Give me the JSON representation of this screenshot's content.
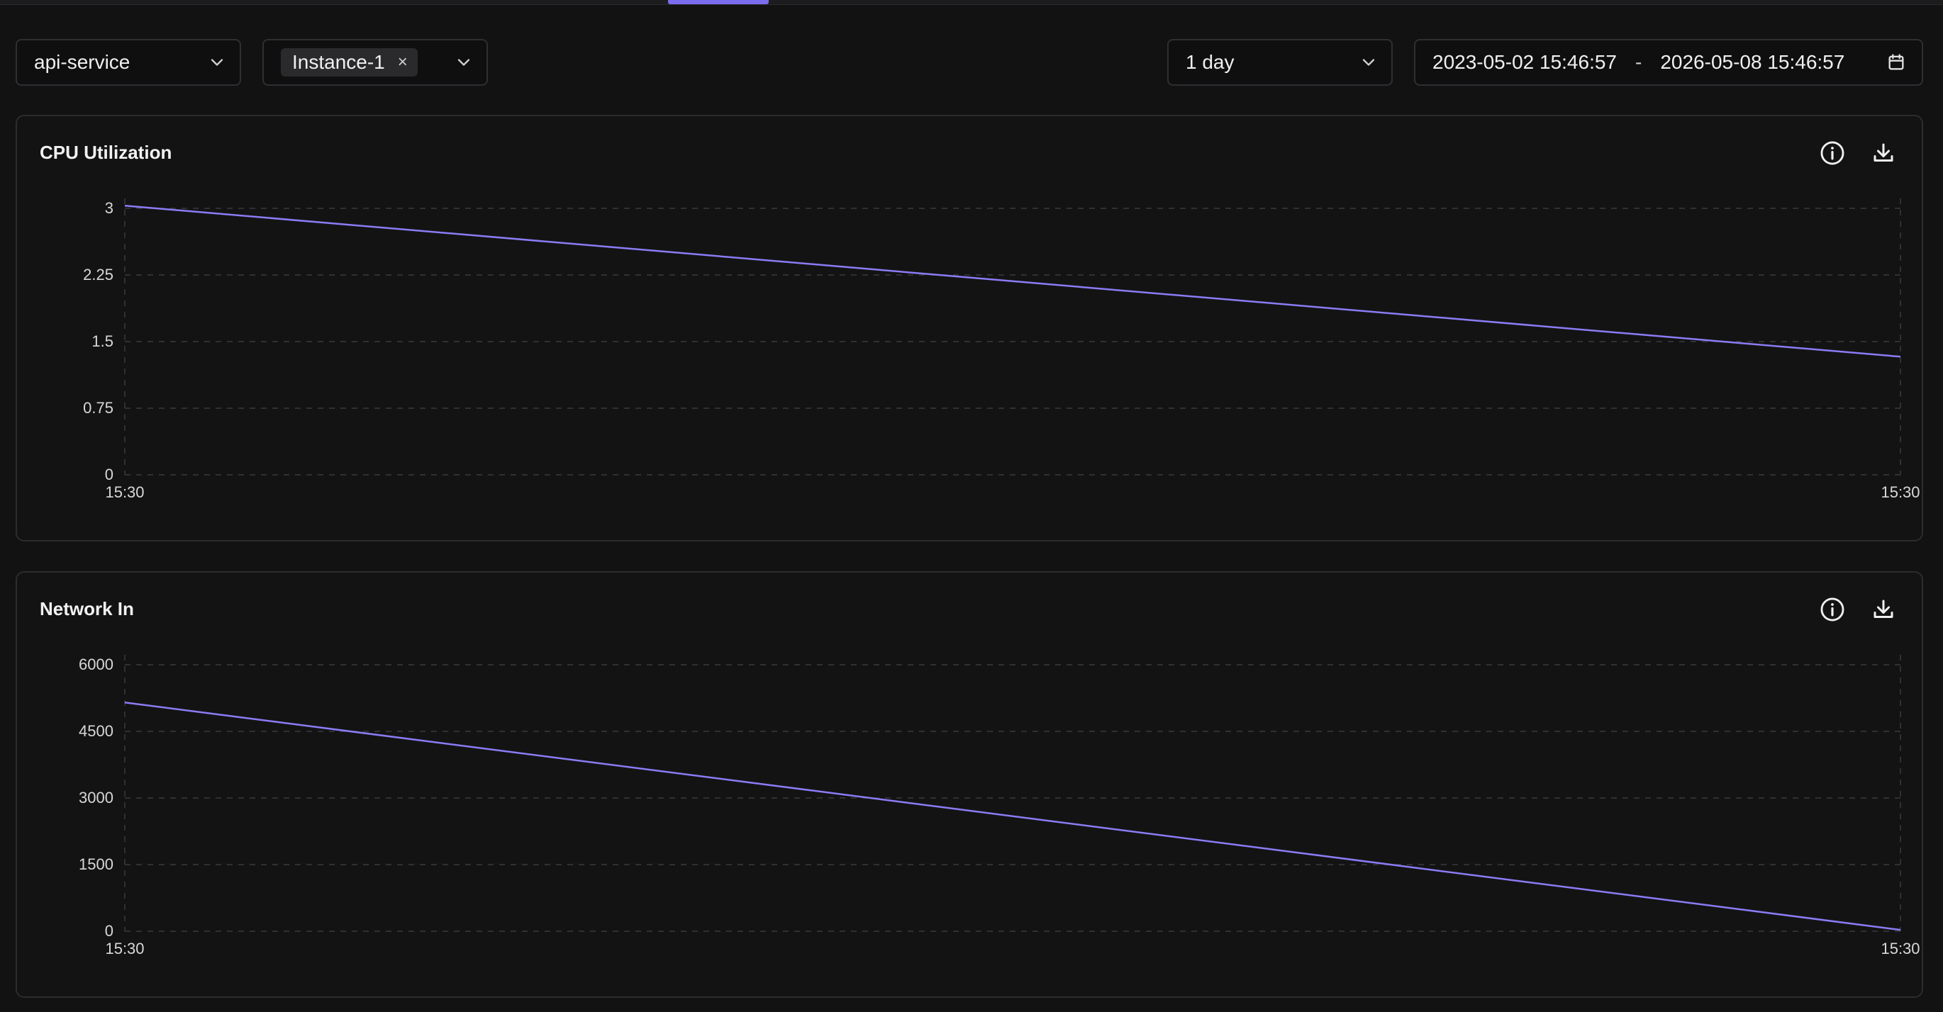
{
  "filters": {
    "service": "api-service",
    "instance_chip": "Instance-1",
    "instance_chip_remove": "×",
    "interval": "1 day",
    "range_start": "2023-05-02 15:46:57",
    "range_separator": "-",
    "range_end": "2026-05-08 15:46:57"
  },
  "colors": {
    "accent": "#7c6cf0",
    "line": "#8b7cf5",
    "grid": "#3a3a3e"
  },
  "icons": {
    "info": "info-icon",
    "download": "download-icon",
    "chevron": "chevron-down-icon",
    "calendar": "calendar-icon"
  },
  "charts": [
    {
      "title": "CPU Utilization",
      "chart_data": {
        "type": "line",
        "title": "CPU Utilization",
        "x": [
          "15:30",
          "15:30"
        ],
        "values": [
          3.03,
          1.33
        ],
        "ylim": [
          0,
          3
        ],
        "yticks": [
          "0",
          "0.75",
          "1.5",
          "2.25",
          "3"
        ],
        "xticks": [
          "15:30",
          "15:30"
        ],
        "grid": true
      }
    },
    {
      "title": "Network In",
      "chart_data": {
        "type": "line",
        "title": "Network In",
        "x": [
          "15:30",
          "15:30"
        ],
        "values": [
          5150,
          30
        ],
        "ylim": [
          0,
          6000
        ],
        "yticks": [
          "0",
          "1500",
          "3000",
          "4500",
          "6000"
        ],
        "xticks": [
          "15:30",
          "15:30"
        ],
        "grid": true
      }
    }
  ]
}
